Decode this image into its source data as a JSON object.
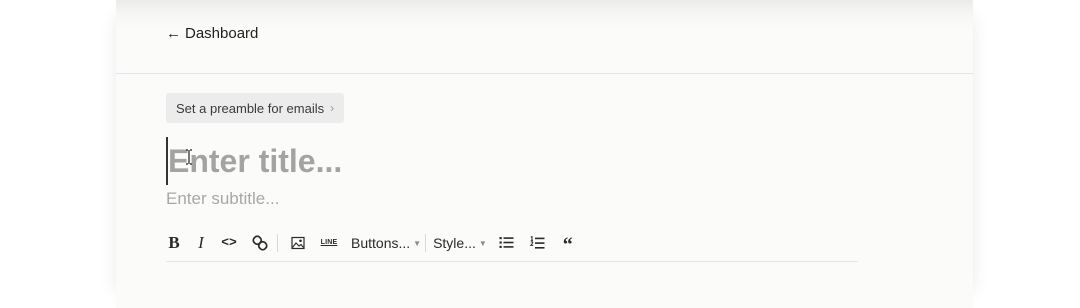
{
  "header": {
    "back_arrow": "←",
    "back_label": "Dashboard"
  },
  "preamble": {
    "label": "Set a preamble for emails",
    "chevron": "›"
  },
  "editor": {
    "title_placeholder": "Enter title...",
    "subtitle_placeholder": "Enter subtitle..."
  },
  "toolbar": {
    "bold": "B",
    "italic": "I",
    "code": "<>",
    "line": "LINE",
    "buttons_label": "Buttons...",
    "style_label": "Style...",
    "caret": "▼",
    "quote": "“",
    "icons": [
      "bold-icon",
      "italic-icon",
      "code-icon",
      "link-icon",
      "image-icon",
      "line-icon",
      "bulleted-list-icon",
      "numbered-list-icon",
      "quote-icon"
    ]
  },
  "colors": {
    "canvas": "#fbfbfa",
    "divider": "#dde6ee",
    "pill": "#ececec",
    "placeholder": "#a3a3a3"
  }
}
